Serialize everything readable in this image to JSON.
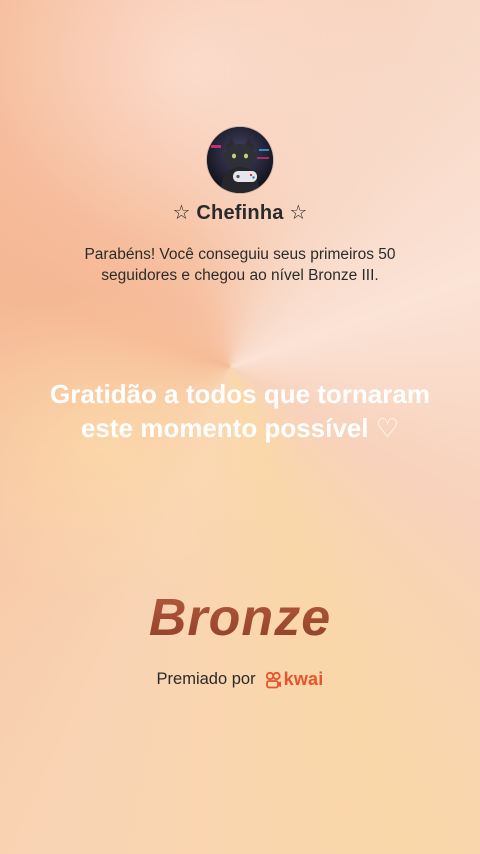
{
  "profile": {
    "username": "☆ Chefinha ☆",
    "avatar_icon": "user-avatar-photo"
  },
  "message": {
    "congrats": "Parabéns! Você conseguiu seus primeiros 50 seguidores e chegou ao nível Bronze III.",
    "gratitude": "Gratidão a todos que tornaram este momento possível ♡"
  },
  "badge": {
    "level": "Bronze"
  },
  "footer": {
    "awarded_by": "Premiado por",
    "brand": "kwai",
    "brand_icon": "kwai-logo-icon"
  },
  "colors": {
    "bronze": "#9c4730",
    "kwai_orange": "#e8542a",
    "text_dark": "#2a2a2a",
    "text_light": "#ffffff"
  }
}
